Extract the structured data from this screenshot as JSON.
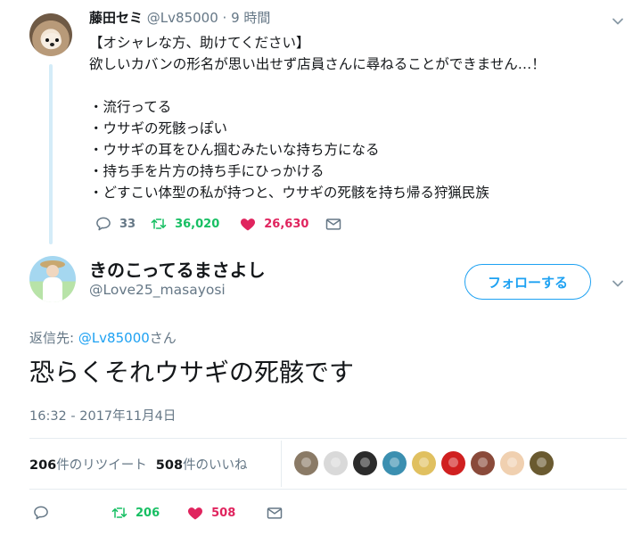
{
  "parent_tweet": {
    "name": "藤田セミ",
    "handle": "@Lv85000",
    "dot": "·",
    "time": "9 時間",
    "text": "【オシャレな方、助けてください】\n欲しいカバンの形名が思い出せず店員さんに尋ねることができません…！\n\n・流行ってる\n・ウサギの死骸っぽい\n・ウサギの耳をひん掴むみたいな持ち方になる\n・持ち手を片方の持ち手にひっかける\n・どすこい体型の私が持つと、ウサギの死骸を持ち帰る狩猟民族",
    "reply_count": "33",
    "retweet_count": "36,020",
    "like_count": "26,630",
    "icons": [
      "reply-icon",
      "retweet-icon",
      "heart-icon",
      "mail-icon",
      "chevron-down-icon"
    ]
  },
  "main_tweet": {
    "name": "きのこってるまさよし",
    "handle": "@Love25_masayosi",
    "follow_label": "フォローする",
    "reply_to_prefix": "返信先: ",
    "reply_to_handle": "@Lv85000",
    "reply_to_suffix": "さん",
    "text": "恐らくそれウサギの死骸です",
    "timestamp": "16:32 - 2017年11月4日",
    "retweets_num": "206",
    "retweets_label": "件のリツイート",
    "likes_num": "508",
    "likes_label": "件のいいね",
    "reply_count": "",
    "retweet_count": "206",
    "like_count": "508"
  },
  "liker_avatars": [
    {
      "name": "liker-1",
      "color": "#8a7a66"
    },
    {
      "name": "liker-2",
      "color": "#d9d9d9"
    },
    {
      "name": "liker-3",
      "color": "#2b2b2b"
    },
    {
      "name": "liker-4",
      "color": "#3b8fb0"
    },
    {
      "name": "liker-5",
      "color": "#e0c060"
    },
    {
      "name": "liker-6",
      "color": "#d02020"
    },
    {
      "name": "liker-7",
      "color": "#8a4a3a"
    },
    {
      "name": "liker-8",
      "color": "#f0d0b0"
    },
    {
      "name": "liker-9",
      "color": "#6a5a30"
    }
  ],
  "colors": {
    "accent": "#1da1f2",
    "retweet": "#17bf63",
    "like": "#e0245e",
    "muted": "#657786"
  }
}
